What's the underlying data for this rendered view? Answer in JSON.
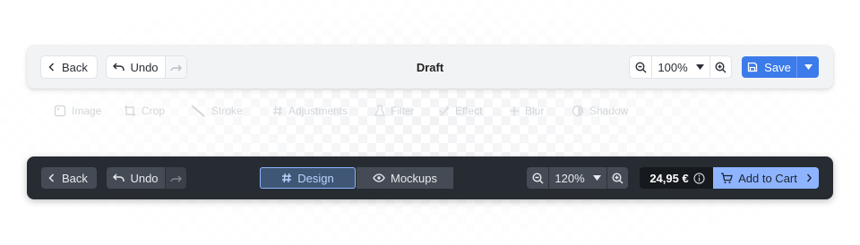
{
  "colors": {
    "accent": "#3c7bea",
    "dark_bar": "#272c33",
    "light_bar": "#f2f3f5",
    "cart": "#8fb4ff"
  },
  "light_toolbar": {
    "back_label": "Back",
    "undo_label": "Undo",
    "title": "Draft",
    "zoom_value": "100%",
    "save_label": "Save"
  },
  "ghost_tools": [
    {
      "label": "Image",
      "icon": "image-icon"
    },
    {
      "label": "Crop",
      "icon": "crop-icon"
    },
    {
      "label": "Stroke",
      "icon": "stroke-icon"
    },
    {
      "label": "Adjustments",
      "icon": "hash-icon"
    },
    {
      "label": "Filter",
      "icon": "filter-icon"
    },
    {
      "label": "Effect",
      "icon": "effect-icon"
    },
    {
      "label": "Blur",
      "icon": "blur-icon"
    },
    {
      "label": "Shadow",
      "icon": "shadow-icon"
    }
  ],
  "dark_toolbar": {
    "back_label": "Back",
    "undo_label": "Undo",
    "tabs": [
      {
        "label": "Design",
        "icon": "hash-icon",
        "active": true
      },
      {
        "label": "Mockups",
        "icon": "eye-icon",
        "active": false
      }
    ],
    "zoom_value": "120%",
    "price": "24,95 €",
    "cart_label": "Add to Cart"
  }
}
